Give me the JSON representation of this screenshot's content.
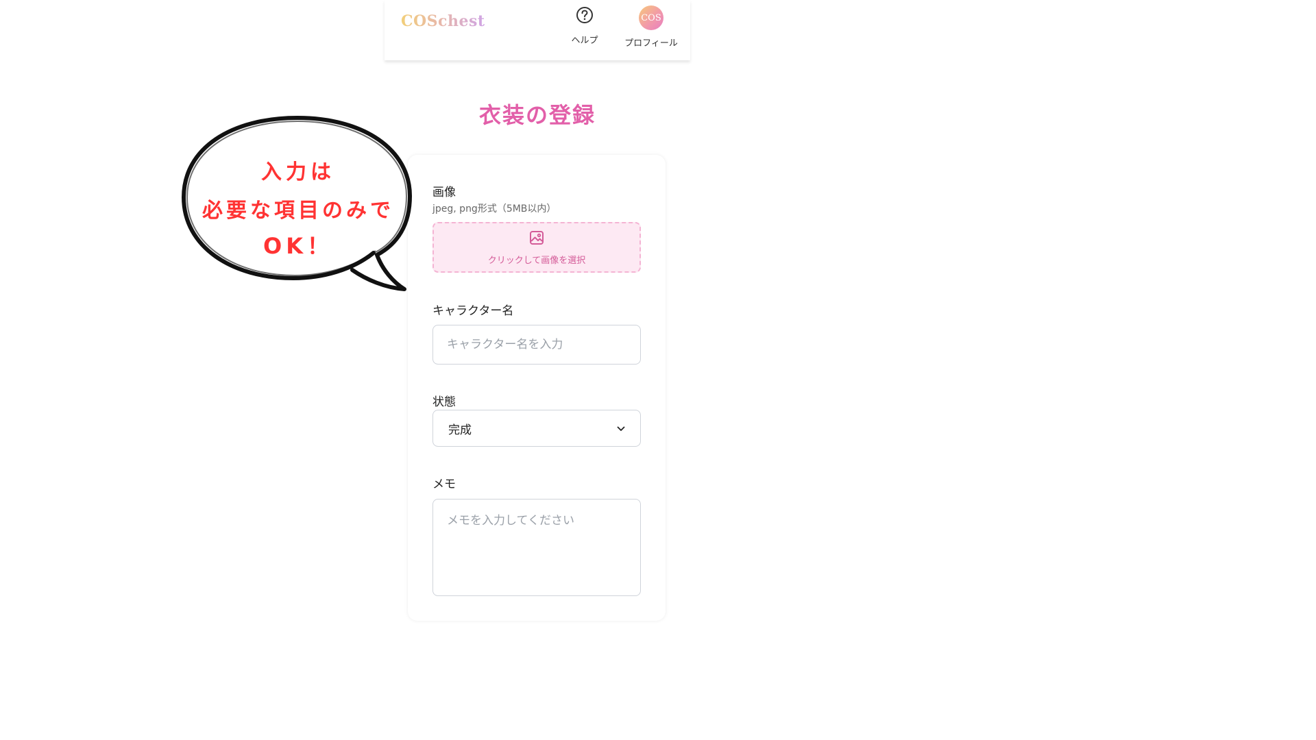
{
  "header": {
    "logo": "COSchest",
    "help_label": "ヘルプ",
    "profile_label": "プロフィール",
    "avatar_text": "COS"
  },
  "page": {
    "title": "衣装の登録"
  },
  "form": {
    "image": {
      "label": "画像",
      "hint": "jpeg, png形式（5MB以内）",
      "upload_text": "クリックして画像を選択"
    },
    "character": {
      "label": "キャラクター名",
      "placeholder": "キャラクター名を入力",
      "value": ""
    },
    "status": {
      "label": "状態",
      "selected": "完成"
    },
    "memo": {
      "label": "メモ",
      "placeholder": "メモを入力してください",
      "value": ""
    }
  },
  "annotation": {
    "line1": "入力は",
    "line2": "必要な項目のみで",
    "line3": "OK！",
    "text_color": "#ff3333"
  },
  "colors": {
    "accent": "#e25fa9",
    "upload_bg": "#fde9f3",
    "upload_border": "#f4b3d3"
  },
  "icons": {
    "help": "question-circle-icon",
    "upload": "image-icon",
    "select": "chevron-down-icon"
  }
}
